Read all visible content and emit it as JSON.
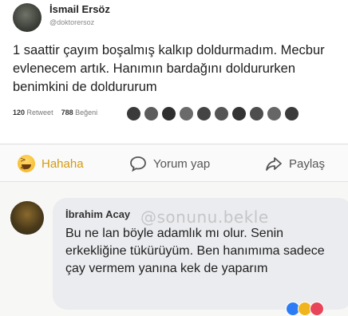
{
  "tweet": {
    "author_name": "İsmail Ersöz",
    "author_handle": "@doktorersoz",
    "text": "1 saattir çayım boşalmış kalkıp doldurmadım. Mecbur evlenecem artık. Hanımın bardağını doldururken benimkini de doldururum",
    "retweet_count": "120",
    "retweet_label": "Retweet",
    "like_count": "788",
    "like_label": "Beğeni",
    "liker_avatar_count": 10
  },
  "actions": {
    "reaction_label": "Hahaha",
    "comment_label": "Yorum yap",
    "share_label": "Paylaş",
    "reaction_color": "#d49a0b"
  },
  "comment": {
    "author_name": "İbrahim Acay",
    "text": "Bu ne lan böyle adamlık mı olur. Senin erkekliğine tükürüyüm. Ben hanımıma sadece çay vermem yanına kek de yaparım",
    "watermark": "@sonunu.bekle"
  }
}
